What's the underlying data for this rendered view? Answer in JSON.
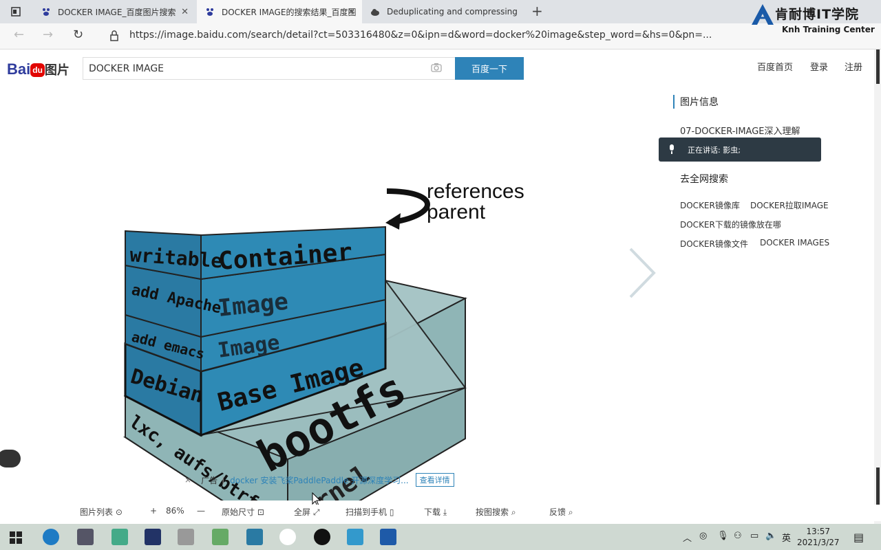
{
  "tabs": [
    {
      "label": "DOCKER IMAGE_百度图片搜索",
      "active": false
    },
    {
      "label": "DOCKER IMAGE的搜索结果_百度图",
      "active": true
    },
    {
      "label": "Deduplicating and compressing",
      "active": false
    }
  ],
  "address_bar": {
    "url": "https://image.baidu.com/search/detail?ct=503316480&z=0&ipn=d&word=docker%20image&step_word=&hs=0&pn=..."
  },
  "brand_overlay": {
    "cn": "肯耐博IT学院",
    "en": "Knh Training Center"
  },
  "header": {
    "logo": {
      "bai": "Bai",
      "du": "du",
      "tupian": "图片"
    },
    "search_value": "DOCKER IMAGE",
    "search_button": "百度一下",
    "links": [
      "百度首页",
      "登录",
      "注册"
    ]
  },
  "diagram": {
    "layers": [
      {
        "left_label": "writable",
        "right_label": "Container"
      },
      {
        "left_label": "add Apache",
        "right_label": "Image"
      },
      {
        "left_label": "add emacs",
        "right_label": "Image"
      },
      {
        "left_label": "Debian",
        "right_label": "Base Image"
      },
      {
        "left_label": "lxc, aufs/btrfs",
        "right_label": "Kernel"
      }
    ],
    "bootfs_label": "bootfs",
    "annotation": [
      "references",
      "parent"
    ]
  },
  "panel": {
    "title": "图片信息",
    "image_name": "07-DOCKER-IMAGE深入理解",
    "speaking": "正在讲话: 影虫;",
    "search_heading": "去全网搜索",
    "related": [
      "DOCKER镜像库",
      "DOCKER拉取IMAGE",
      "DOCKER下载的镜像放在哪",
      "DOCKER镜像文件",
      "DOCKER IMAGES"
    ]
  },
  "ad": {
    "close": "×",
    "tag": "广告",
    "text": "docker 安装飞桨PaddlePaddle 开源深度学习...",
    "button": "查看详情"
  },
  "bottombar": {
    "list": "图片列表",
    "zoom_in": "+",
    "zoom": "86%",
    "zoom_out": "—",
    "original": "原始尺寸",
    "fullscreen": "全屏",
    "scan": "扫描到手机",
    "download": "下载",
    "search_by_image": "按图搜索",
    "feedback": "反馈"
  },
  "taskbar": {
    "time": "13:57",
    "date": "2021/3/27",
    "ime": "英"
  },
  "colors": {
    "layer_blue": "#2e8ab5",
    "layer_side": "#2a7aa3",
    "kernel": "#8fb5b6",
    "accent": "#2e83b8"
  }
}
